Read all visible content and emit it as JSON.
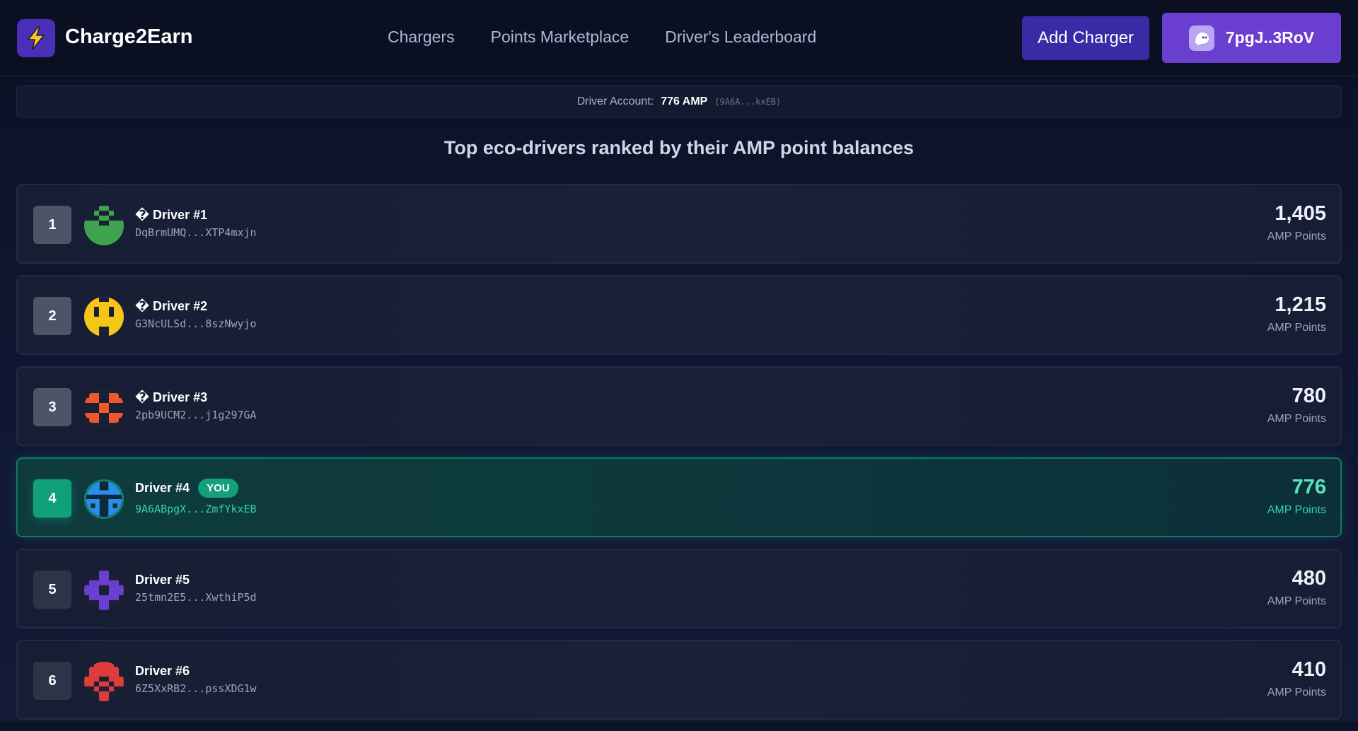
{
  "app": {
    "name": "Charge2Earn",
    "logo_icon": "lightning-bolt-icon"
  },
  "nav": {
    "items": [
      "Chargers",
      "Points Marketplace",
      "Driver's Leaderboard"
    ]
  },
  "header": {
    "add_charger_label": "Add Charger",
    "wallet_label": "7pgJ..3RoV",
    "wallet_icon": "ghost-icon"
  },
  "account": {
    "label": "Driver Account:",
    "amp": "776 AMP",
    "address": "(9A6A...kxEB)"
  },
  "subtitle": "Top eco-drivers ranked by their AMP point balances",
  "leaderboard": [
    {
      "rank": "1",
      "name": "� Driver #1",
      "address": "DqBrmUMQ...XTP4mxjn",
      "points": "1,405",
      "points_label": "AMP Points",
      "avatar_color": "#3fa34d",
      "you": false
    },
    {
      "rank": "2",
      "name": "� Driver #2",
      "address": "G3NcULSd...8szNwyjo",
      "points": "1,215",
      "points_label": "AMP Points",
      "avatar_color": "#f5c518",
      "you": false
    },
    {
      "rank": "3",
      "name": "� Driver #3",
      "address": "2pb9UCM2...j1g297GA",
      "points": "780",
      "points_label": "AMP Points",
      "avatar_color": "#f0572a",
      "you": false
    },
    {
      "rank": "4",
      "name": "Driver #4",
      "badge": "YOU",
      "address": "9A6ABpgX...ZmfYkxEB",
      "points": "776",
      "points_label": "AMP Points",
      "avatar_color": "#2a8ee8",
      "you": true
    },
    {
      "rank": "5",
      "name": "Driver #5",
      "address": "25tmn2E5...XwthiP5d",
      "points": "480",
      "points_label": "AMP Points",
      "avatar_color": "#6a3fd0",
      "you": false
    },
    {
      "rank": "6",
      "name": "Driver #6",
      "address": "6Z5XxRB2...pssXDG1w",
      "points": "410",
      "points_label": "AMP Points",
      "avatar_color": "#e03a3a",
      "you": false
    }
  ]
}
